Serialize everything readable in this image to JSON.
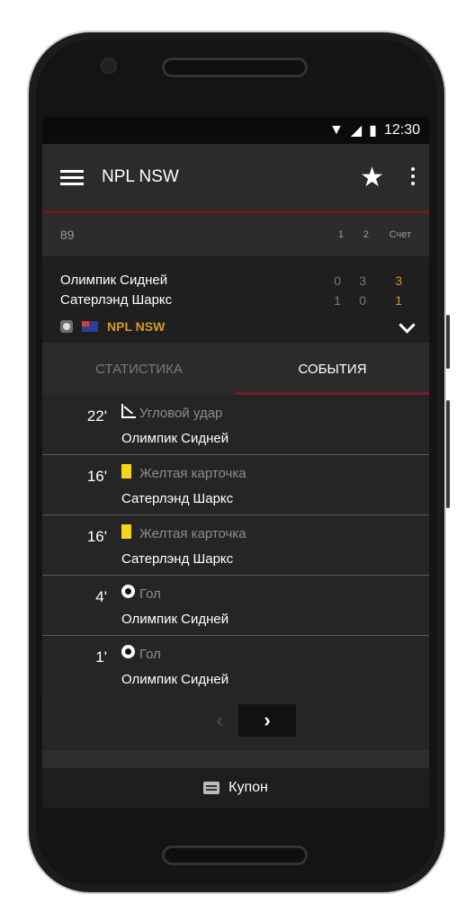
{
  "status_bar": {
    "time": "12:30"
  },
  "app_bar": {
    "title": "NPL NSW"
  },
  "score_header": {
    "minute": "89",
    "col1": "1",
    "col2": "2",
    "col_total": "Счет"
  },
  "match": {
    "home_team": "Олимпик Сидней",
    "away_team": "Сатерлэнд Шаркс",
    "home_scores": [
      "0",
      "3",
      "3"
    ],
    "away_scores": [
      "1",
      "0",
      "1"
    ],
    "league": "NPL NSW"
  },
  "tabs": [
    {
      "label": "СТАТИСТИКА",
      "active": false
    },
    {
      "label": "СОБЫТИЯ",
      "active": true
    }
  ],
  "events": [
    {
      "minute": "22'",
      "type": "Угловой удар",
      "icon": "corner-flag-icon",
      "team": "Олимпик Сидней"
    },
    {
      "minute": "16'",
      "type": "Желтая карточка",
      "icon": "yellow-card-icon",
      "team": "Сатерлэнд Шаркс"
    },
    {
      "minute": "16'",
      "type": "Желтая карточка",
      "icon": "yellow-card-icon",
      "team": "Сатерлэнд Шаркс"
    },
    {
      "minute": "4'",
      "type": "Гол",
      "icon": "ball-icon",
      "team": "Олимпик Сидней"
    },
    {
      "minute": "1'",
      "type": "Гол",
      "icon": "ball-icon",
      "team": "Олимпик Сидней"
    }
  ],
  "pager": {
    "prev": "‹",
    "next": "›"
  },
  "coupon": {
    "label": "Купон"
  },
  "colors": {
    "accent": "#d19a27",
    "tab_indicator": "#7a1c2a",
    "yellow_card": "#f3d51b"
  }
}
